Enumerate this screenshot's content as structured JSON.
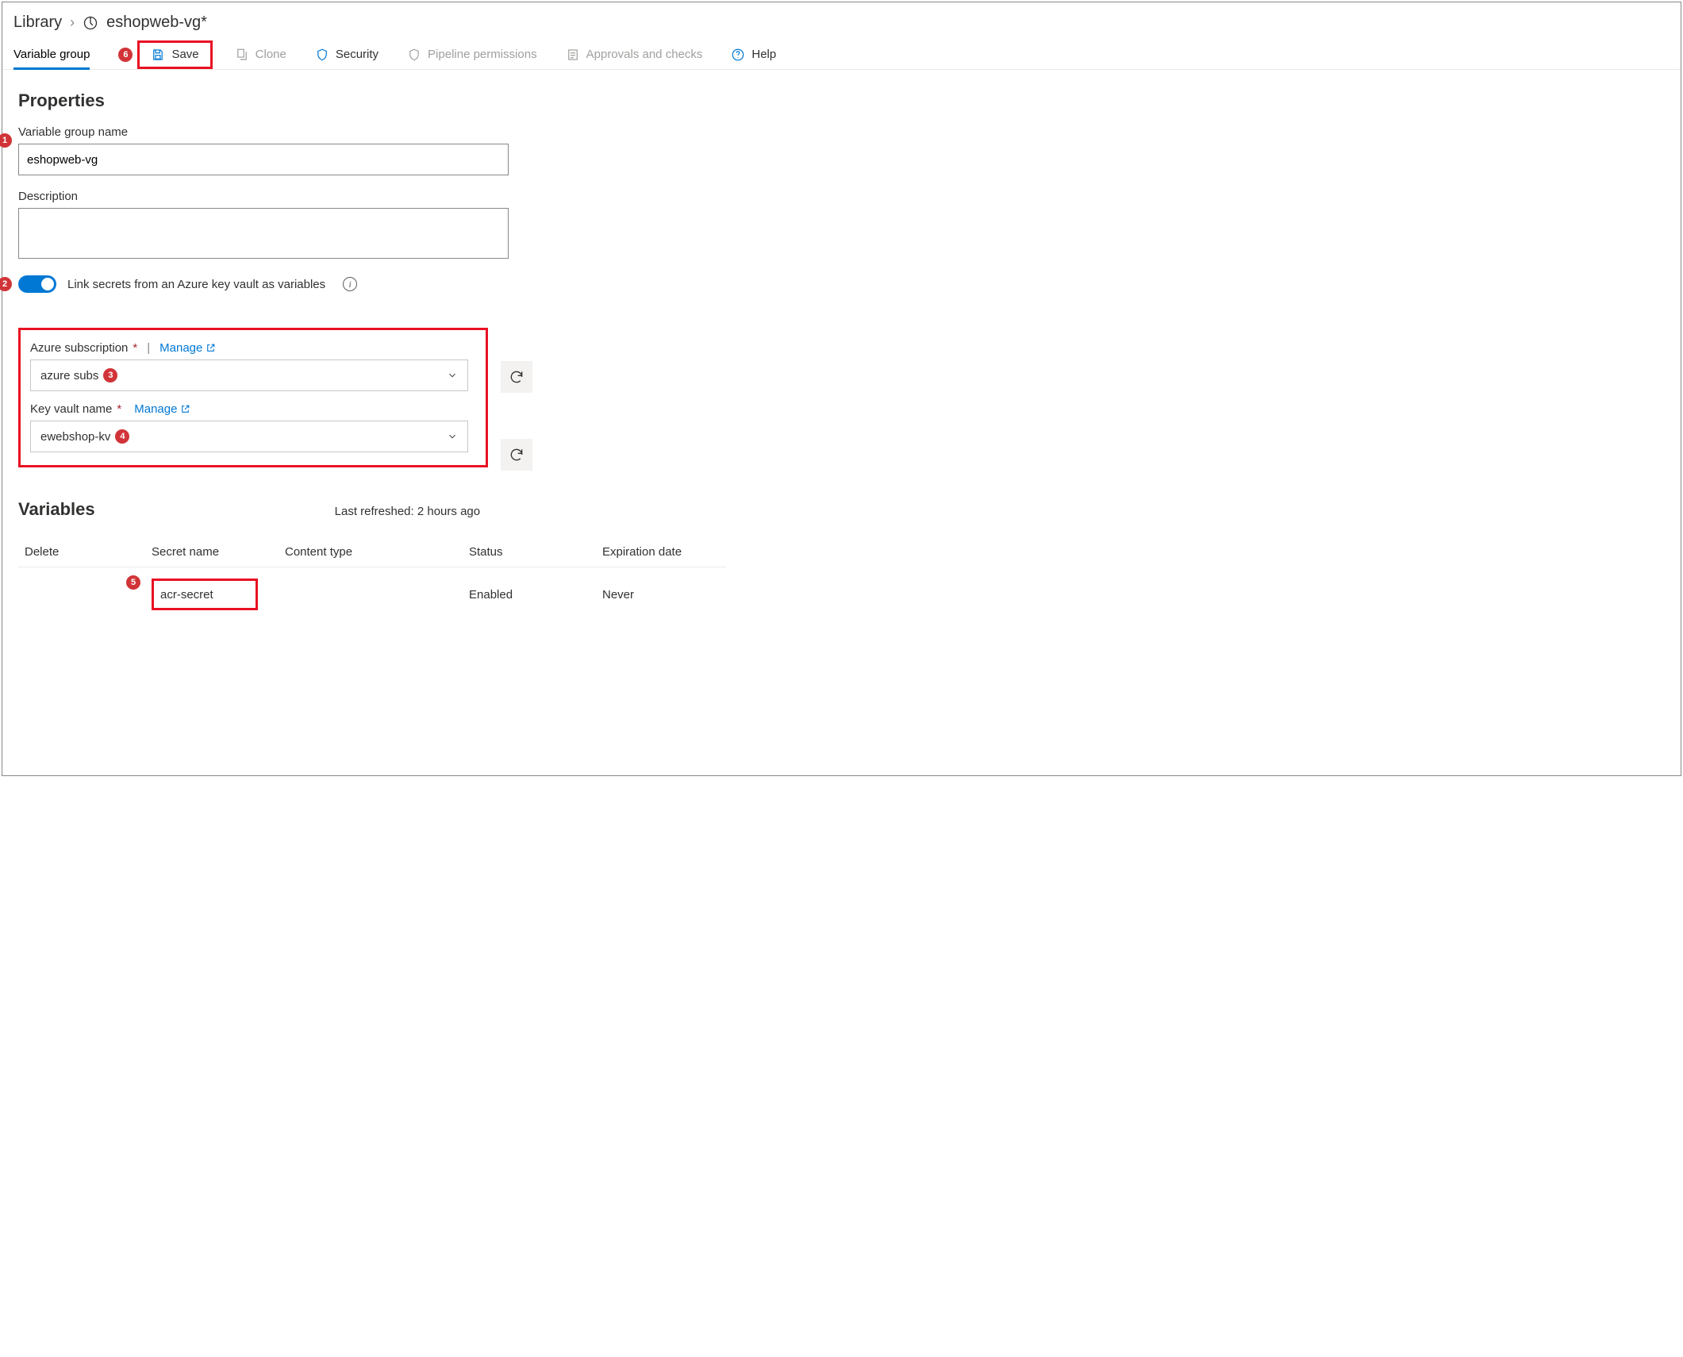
{
  "breadcrumb": {
    "library": "Library",
    "title": "eshopweb-vg*"
  },
  "tabs": {
    "active": "Variable group"
  },
  "commands": {
    "save": "Save",
    "clone": "Clone",
    "security": "Security",
    "pipeline_permissions": "Pipeline permissions",
    "approvals": "Approvals and checks",
    "help": "Help"
  },
  "badges": {
    "save": "6",
    "name": "1",
    "toggle": "2",
    "subscription": "3",
    "keyvault": "4",
    "secret": "5"
  },
  "properties": {
    "heading": "Properties",
    "name_label": "Variable group name",
    "name_value": "eshopweb-vg",
    "description_label": "Description",
    "description_value": "",
    "link_secrets_label": "Link secrets from an Azure key vault as variables"
  },
  "keyvault": {
    "subscription_label": "Azure subscription",
    "subscription_value": "azure subs",
    "keyvault_label": "Key vault name",
    "keyvault_value": "ewebshop-kv",
    "manage": "Manage"
  },
  "variables": {
    "heading": "Variables",
    "last_refreshed": "Last refreshed: 2 hours ago",
    "columns": {
      "delete": "Delete",
      "secret_name": "Secret name",
      "content_type": "Content type",
      "status": "Status",
      "expiration": "Expiration date"
    },
    "rows": [
      {
        "secret_name": "acr-secret",
        "content_type": "",
        "status": "Enabled",
        "expiration": "Never"
      }
    ]
  }
}
